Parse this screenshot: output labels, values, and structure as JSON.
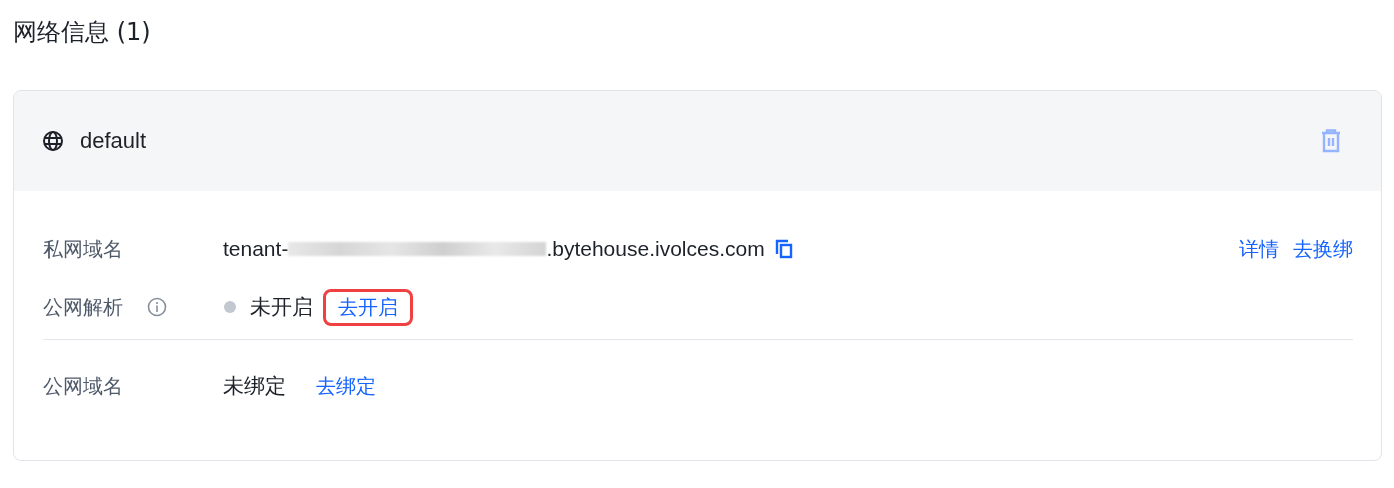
{
  "title": "网络信息 (1)",
  "network": {
    "name": "default",
    "private_domain": {
      "label": "私网域名",
      "prefix": "tenant-",
      "suffix": ".bytehouse.ivolces.com",
      "actions": [
        "详情",
        "去换绑"
      ]
    },
    "public_resolution": {
      "label": "公网解析",
      "enabled": false,
      "status": "未开启",
      "action": "去开启",
      "highlighted": true
    },
    "public_domain": {
      "label": "公网域名",
      "status": "未绑定",
      "action": "去绑定"
    }
  }
}
